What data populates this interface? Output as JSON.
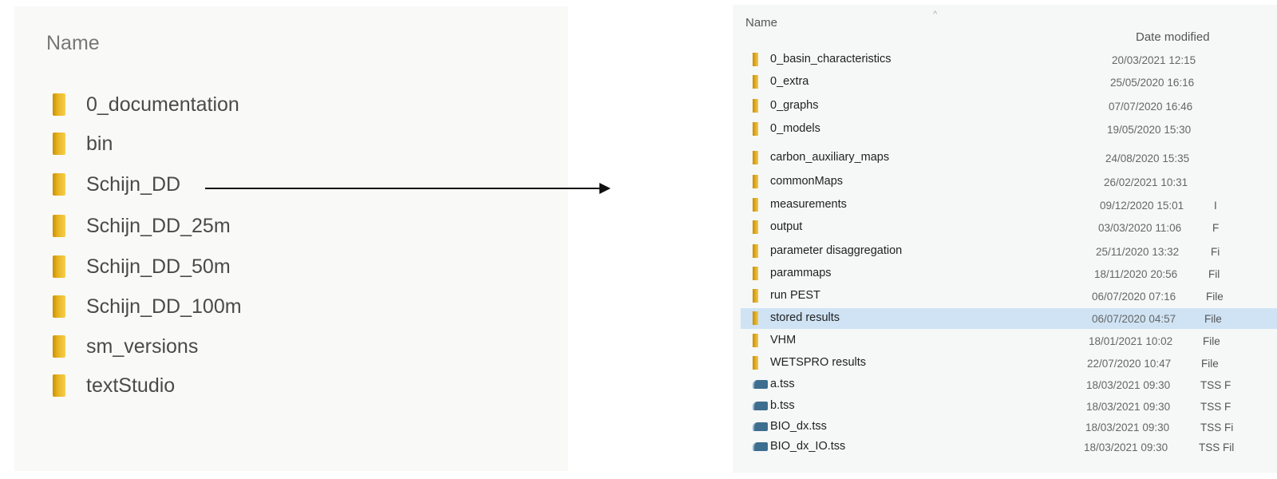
{
  "left_panel": {
    "column_header": "Name",
    "items": [
      {
        "label": "0_documentation",
        "icon": "folder-icon"
      },
      {
        "label": "bin",
        "icon": "folder-icon"
      },
      {
        "label": "Schijn_DD",
        "icon": "folder-icon"
      },
      {
        "label": "Schijn_DD_25m",
        "icon": "folder-icon"
      },
      {
        "label": "Schijn_DD_50m",
        "icon": "folder-icon"
      },
      {
        "label": "Schijn_DD_100m",
        "icon": "folder-icon"
      },
      {
        "label": "sm_versions",
        "icon": "folder-icon"
      },
      {
        "label": "textStudio",
        "icon": "folder-icon"
      }
    ]
  },
  "arrow": {
    "from": "Schijn_DD",
    "icon": "arrow-right-icon"
  },
  "right_panel": {
    "header_name": "Name",
    "header_date": "Date modified",
    "sort_indicator": "^",
    "selected_item": "stored results",
    "rows": [
      {
        "name": "0_basin_characteristics",
        "date": "20/03/2021 12:15",
        "type": "",
        "kind": "folder"
      },
      {
        "name": "0_extra",
        "date": "25/05/2020 16:16",
        "type": "",
        "kind": "folder"
      },
      {
        "name": "0_graphs",
        "date": "07/07/2020 16:46",
        "type": "",
        "kind": "folder"
      },
      {
        "name": "0_models",
        "date": "19/05/2020 15:30",
        "type": "",
        "kind": "folder"
      },
      {
        "name": "carbon_auxiliary_maps",
        "date": "24/08/2020 15:35",
        "type": "",
        "kind": "folder"
      },
      {
        "name": "commonMaps",
        "date": "26/02/2021 10:31",
        "type": "",
        "kind": "folder"
      },
      {
        "name": "measurements",
        "date": "09/12/2020 15:01",
        "type": "I",
        "kind": "folder"
      },
      {
        "name": "output",
        "date": "03/03/2020 11:06",
        "type": "F",
        "kind": "folder"
      },
      {
        "name": "parameter disaggregation",
        "date": "25/11/2020 13:32",
        "type": "Fi",
        "kind": "folder"
      },
      {
        "name": "parammaps",
        "date": "18/11/2020 20:56",
        "type": "Fil",
        "kind": "folder"
      },
      {
        "name": "run PEST",
        "date": "06/07/2020 07:16",
        "type": "File",
        "kind": "folder"
      },
      {
        "name": "stored results",
        "date": "06/07/2020 04:57",
        "type": "File",
        "kind": "folder"
      },
      {
        "name": "VHM",
        "date": "18/01/2021 10:02",
        "type": "File",
        "kind": "folder"
      },
      {
        "name": "WETSPRO results",
        "date": "22/07/2020 10:47",
        "type": "File",
        "kind": "folder"
      },
      {
        "name": "a.tss",
        "date": "18/03/2021 09:30",
        "type": "TSS F",
        "kind": "file"
      },
      {
        "name": "b.tss",
        "date": "18/03/2021 09:30",
        "type": "TSS F",
        "kind": "file"
      },
      {
        "name": "BIO_dx.tss",
        "date": "18/03/2021 09:30",
        "type": "TSS Fi",
        "kind": "file"
      },
      {
        "name": "BIO_dx_IO.tss",
        "date": "18/03/2021 09:30",
        "type": "TSS Fil",
        "kind": "file"
      }
    ]
  }
}
